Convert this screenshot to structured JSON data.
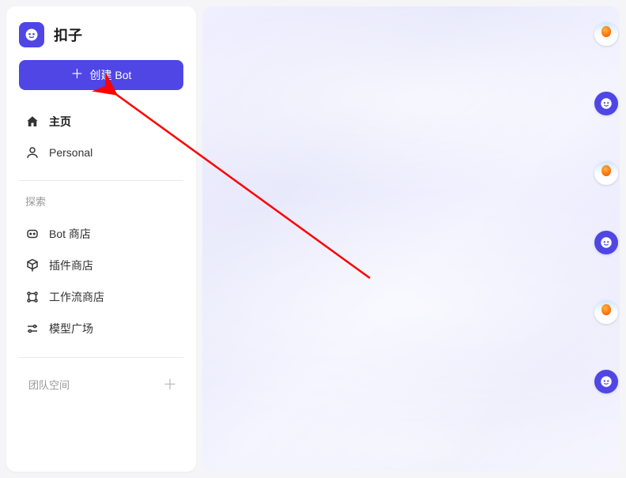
{
  "brand": {
    "name": "扣子"
  },
  "sidebar": {
    "create_label": "创建 Bot",
    "nav": {
      "home": "主页",
      "personal": "Personal"
    },
    "explore_title": "探索",
    "explore": {
      "bot_store": "Bot 商店",
      "plugin_store": "插件商店",
      "workflow_store": "工作流商店",
      "model_plaza": "模型广场"
    },
    "team_space_title": "团队空间"
  },
  "float_items": [
    {
      "kind": "balloon"
    },
    {
      "kind": "bot"
    },
    {
      "kind": "balloon"
    },
    {
      "kind": "bot"
    },
    {
      "kind": "balloon"
    },
    {
      "kind": "bot"
    }
  ],
  "colors": {
    "primary": "#4f46e5",
    "arrow": "#ff0000"
  }
}
